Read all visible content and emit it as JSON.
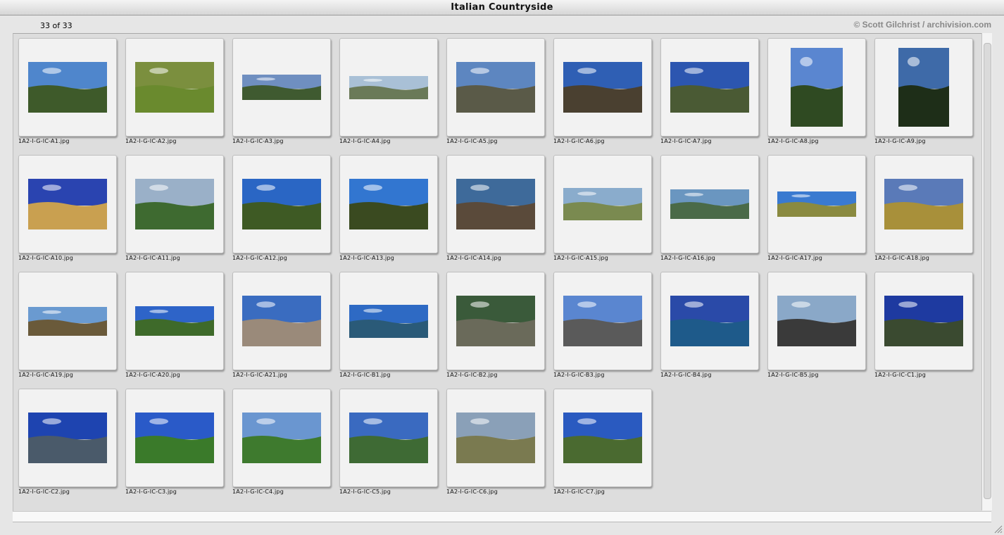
{
  "window": {
    "title": "Italian Countryside"
  },
  "info": {
    "count": "33 of 33",
    "credit": "© Scott Gilchrist / archivision.com"
  },
  "thumbnails": [
    {
      "name": "1A2-I-G-IC-A1.jpg",
      "w": 112,
      "h": 72,
      "sky": "#4f86cc",
      "land": "#3e5a2a"
    },
    {
      "name": "1A2-I-G-IC-A2.jpg",
      "w": 112,
      "h": 72,
      "sky": "#7b8f3e",
      "land": "#6a8a2e"
    },
    {
      "name": "1A2-I-G-IC-A3.jpg",
      "w": 112,
      "h": 36,
      "sky": "#6f8fc0",
      "land": "#3f5a30"
    },
    {
      "name": "1A2-I-G-IC-A4.jpg",
      "w": 112,
      "h": 33,
      "sky": "#a9c0d6",
      "land": "#6a7a58"
    },
    {
      "name": "1A2-I-G-IC-A5.jpg",
      "w": 112,
      "h": 72,
      "sky": "#5d86c0",
      "land": "#5a5a48"
    },
    {
      "name": "1A2-I-G-IC-A6.jpg",
      "w": 112,
      "h": 72,
      "sky": "#2f5fb4",
      "land": "#4a4030"
    },
    {
      "name": "1A2-I-G-IC-A7.jpg",
      "w": 112,
      "h": 72,
      "sky": "#2c56b0",
      "land": "#4a5a34"
    },
    {
      "name": "1A2-I-G-IC-A8.jpg",
      "w": 74,
      "h": 112,
      "sky": "#5a86d0",
      "land": "#2f4a22"
    },
    {
      "name": "1A2-I-G-IC-A9.jpg",
      "w": 72,
      "h": 112,
      "sky": "#3e6aa8",
      "land": "#1e2e18"
    },
    {
      "name": "1A2-I-G-IC-A10.jpg",
      "w": 112,
      "h": 72,
      "sky": "#2a44b0",
      "land": "#c9a050"
    },
    {
      "name": "1A2-I-G-IC-A11.jpg",
      "w": 112,
      "h": 72,
      "sky": "#9ab0c8",
      "land": "#3e6a30"
    },
    {
      "name": "1A2-I-G-IC-A12.jpg",
      "w": 112,
      "h": 72,
      "sky": "#2a66c4",
      "land": "#3e5a24"
    },
    {
      "name": "1A2-I-G-IC-A13.jpg",
      "w": 112,
      "h": 72,
      "sky": "#3276d0",
      "land": "#3a4a20"
    },
    {
      "name": "1A2-I-G-IC-A14.jpg",
      "w": 112,
      "h": 72,
      "sky": "#3e6a9a",
      "land": "#5a4a3a"
    },
    {
      "name": "1A2-I-G-IC-A15.jpg",
      "w": 112,
      "h": 46,
      "sky": "#8aaccc",
      "land": "#7a8a50"
    },
    {
      "name": "1A2-I-G-IC-A16.jpg",
      "w": 112,
      "h": 42,
      "sky": "#6a96c0",
      "land": "#4a6a48"
    },
    {
      "name": "1A2-I-G-IC-A17.jpg",
      "w": 112,
      "h": 36,
      "sky": "#3a7ad0",
      "land": "#8a8a40"
    },
    {
      "name": "1A2-I-G-IC-A18.jpg",
      "w": 112,
      "h": 72,
      "sky": "#5a7ab8",
      "land": "#a8903a"
    },
    {
      "name": "1A2-I-G-IC-A19.jpg",
      "w": 112,
      "h": 41,
      "sky": "#6a9ad0",
      "land": "#6a5a3a"
    },
    {
      "name": "1A2-I-G-IC-A20.jpg",
      "w": 112,
      "h": 42,
      "sky": "#2e64c8",
      "land": "#3e6a2a"
    },
    {
      "name": "1A2-I-G-IC-A21.jpg",
      "w": 112,
      "h": 72,
      "sky": "#3a6cc0",
      "land": "#9a8a7a"
    },
    {
      "name": "1A2-I-G-IC-B1.jpg",
      "w": 112,
      "h": 47,
      "sky": "#2e6ac4",
      "land": "#2a5a78"
    },
    {
      "name": "1A2-I-G-IC-B2.jpg",
      "w": 112,
      "h": 72,
      "sky": "#3a5a3a",
      "land": "#6a6a5a"
    },
    {
      "name": "1A2-I-G-IC-B3.jpg",
      "w": 112,
      "h": 72,
      "sky": "#5a86d0",
      "land": "#5a5a5a"
    },
    {
      "name": "1A2-I-G-IC-B4.jpg",
      "w": 112,
      "h": 72,
      "sky": "#2a4aa8",
      "land": "#1e5a8a"
    },
    {
      "name": "1A2-I-G-IC-B5.jpg",
      "w": 112,
      "h": 72,
      "sky": "#8aa8c8",
      "land": "#3a3a3a"
    },
    {
      "name": "1A2-I-G-IC-C1.jpg",
      "w": 112,
      "h": 72,
      "sky": "#1e3aa0",
      "land": "#3a4a30"
    },
    {
      "name": "1A2-I-G-IC-C2.jpg",
      "w": 112,
      "h": 72,
      "sky": "#1e44b0",
      "land": "#4a5a6a"
    },
    {
      "name": "1A2-I-G-IC-C3.jpg",
      "w": 112,
      "h": 72,
      "sky": "#2a5ac8",
      "land": "#3a7a2a"
    },
    {
      "name": "1A2-I-G-IC-C4.jpg",
      "w": 112,
      "h": 72,
      "sky": "#6a96d0",
      "land": "#3e7a2e"
    },
    {
      "name": "1A2-I-G-IC-C5.jpg",
      "w": 112,
      "h": 72,
      "sky": "#3a6ac0",
      "land": "#3e6a34"
    },
    {
      "name": "1A2-I-G-IC-C6.jpg",
      "w": 112,
      "h": 72,
      "sky": "#8aa0b8",
      "land": "#7a7a50"
    },
    {
      "name": "1A2-I-G-IC-C7.jpg",
      "w": 112,
      "h": 72,
      "sky": "#2a5ac0",
      "land": "#4a6a30"
    }
  ]
}
